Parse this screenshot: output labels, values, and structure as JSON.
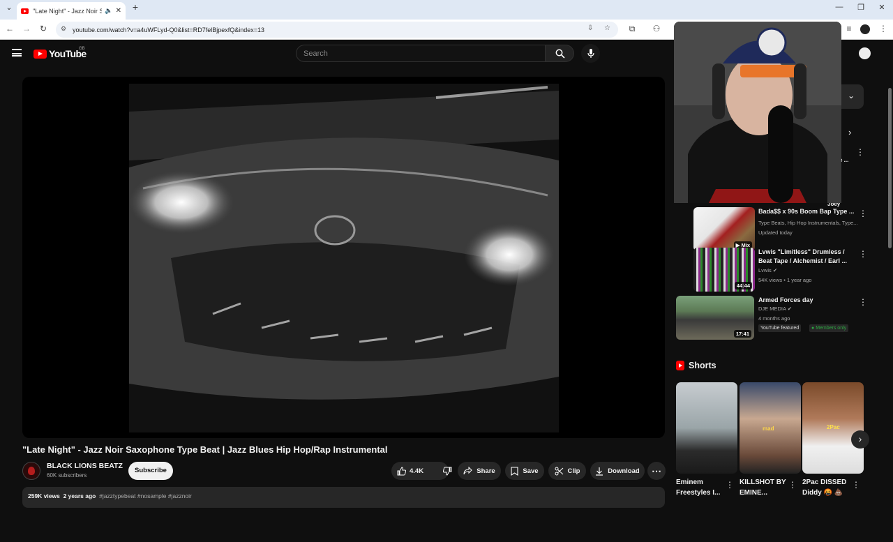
{
  "browser": {
    "tab_title": "\"Late Night\" - Jazz Noir Saxo",
    "url": "youtube.com/watch?v=a4uWFLyd-Q0&list=RD7felBjpexfQ&index=13"
  },
  "header": {
    "logo": "YouTube",
    "country": "GB",
    "search_placeholder": "Search"
  },
  "video": {
    "title": "\"Late Night\" - Jazz Noir Saxophone Type Beat | Jazz Blues Hip Hop/Rap Instrumental",
    "channel": "BLACK LIONS BEATZ",
    "subscribers": "60K subscribers",
    "subscribe_label": "Subscribe",
    "likes": "4.4K",
    "share_label": "Share",
    "save_label": "Save",
    "clip_label": "Clip",
    "download_label": "Download",
    "views": "259K views",
    "age": "2 years ago",
    "tags": "#jazztypebeat #nosample #jazznoir"
  },
  "sidebar": {
    "partial_top_text": "e ...",
    "partial_label": "Joey",
    "items": [
      {
        "title": "Bada$$ x 90s Boom Bap Type ...",
        "line1": "Type Beats, Hip Hop Instrumentals, Type...",
        "line2": "Updated today",
        "duration": "Mix"
      },
      {
        "title": "Lvwis \"Limitless\" Drumless / Beat Tape / Alchemist / Earl ...",
        "line1": "Lvwis",
        "line2": "54K views • 1 year ago",
        "duration": "44:44"
      },
      {
        "title": "Armed Forces day",
        "line1": "DJE MEDIA",
        "line2": "4 months ago",
        "duration": "17:41",
        "badge1": "YouTube featured",
        "badge2": "Members only"
      }
    ],
    "shorts_heading": "Shorts",
    "shorts": [
      {
        "title": "Eminem Freestyles I..."
      },
      {
        "title": "KILLSHOT BY EMINE..."
      },
      {
        "title": "2Pac DISSED Diddy 🤬 💩"
      }
    ],
    "shorts_overlay_2": "mad",
    "shorts_overlay_3": "2Pac"
  },
  "colors": {
    "background": "#0f0f0f",
    "accent": "#ff0000",
    "members_badge": "#2ba640"
  }
}
